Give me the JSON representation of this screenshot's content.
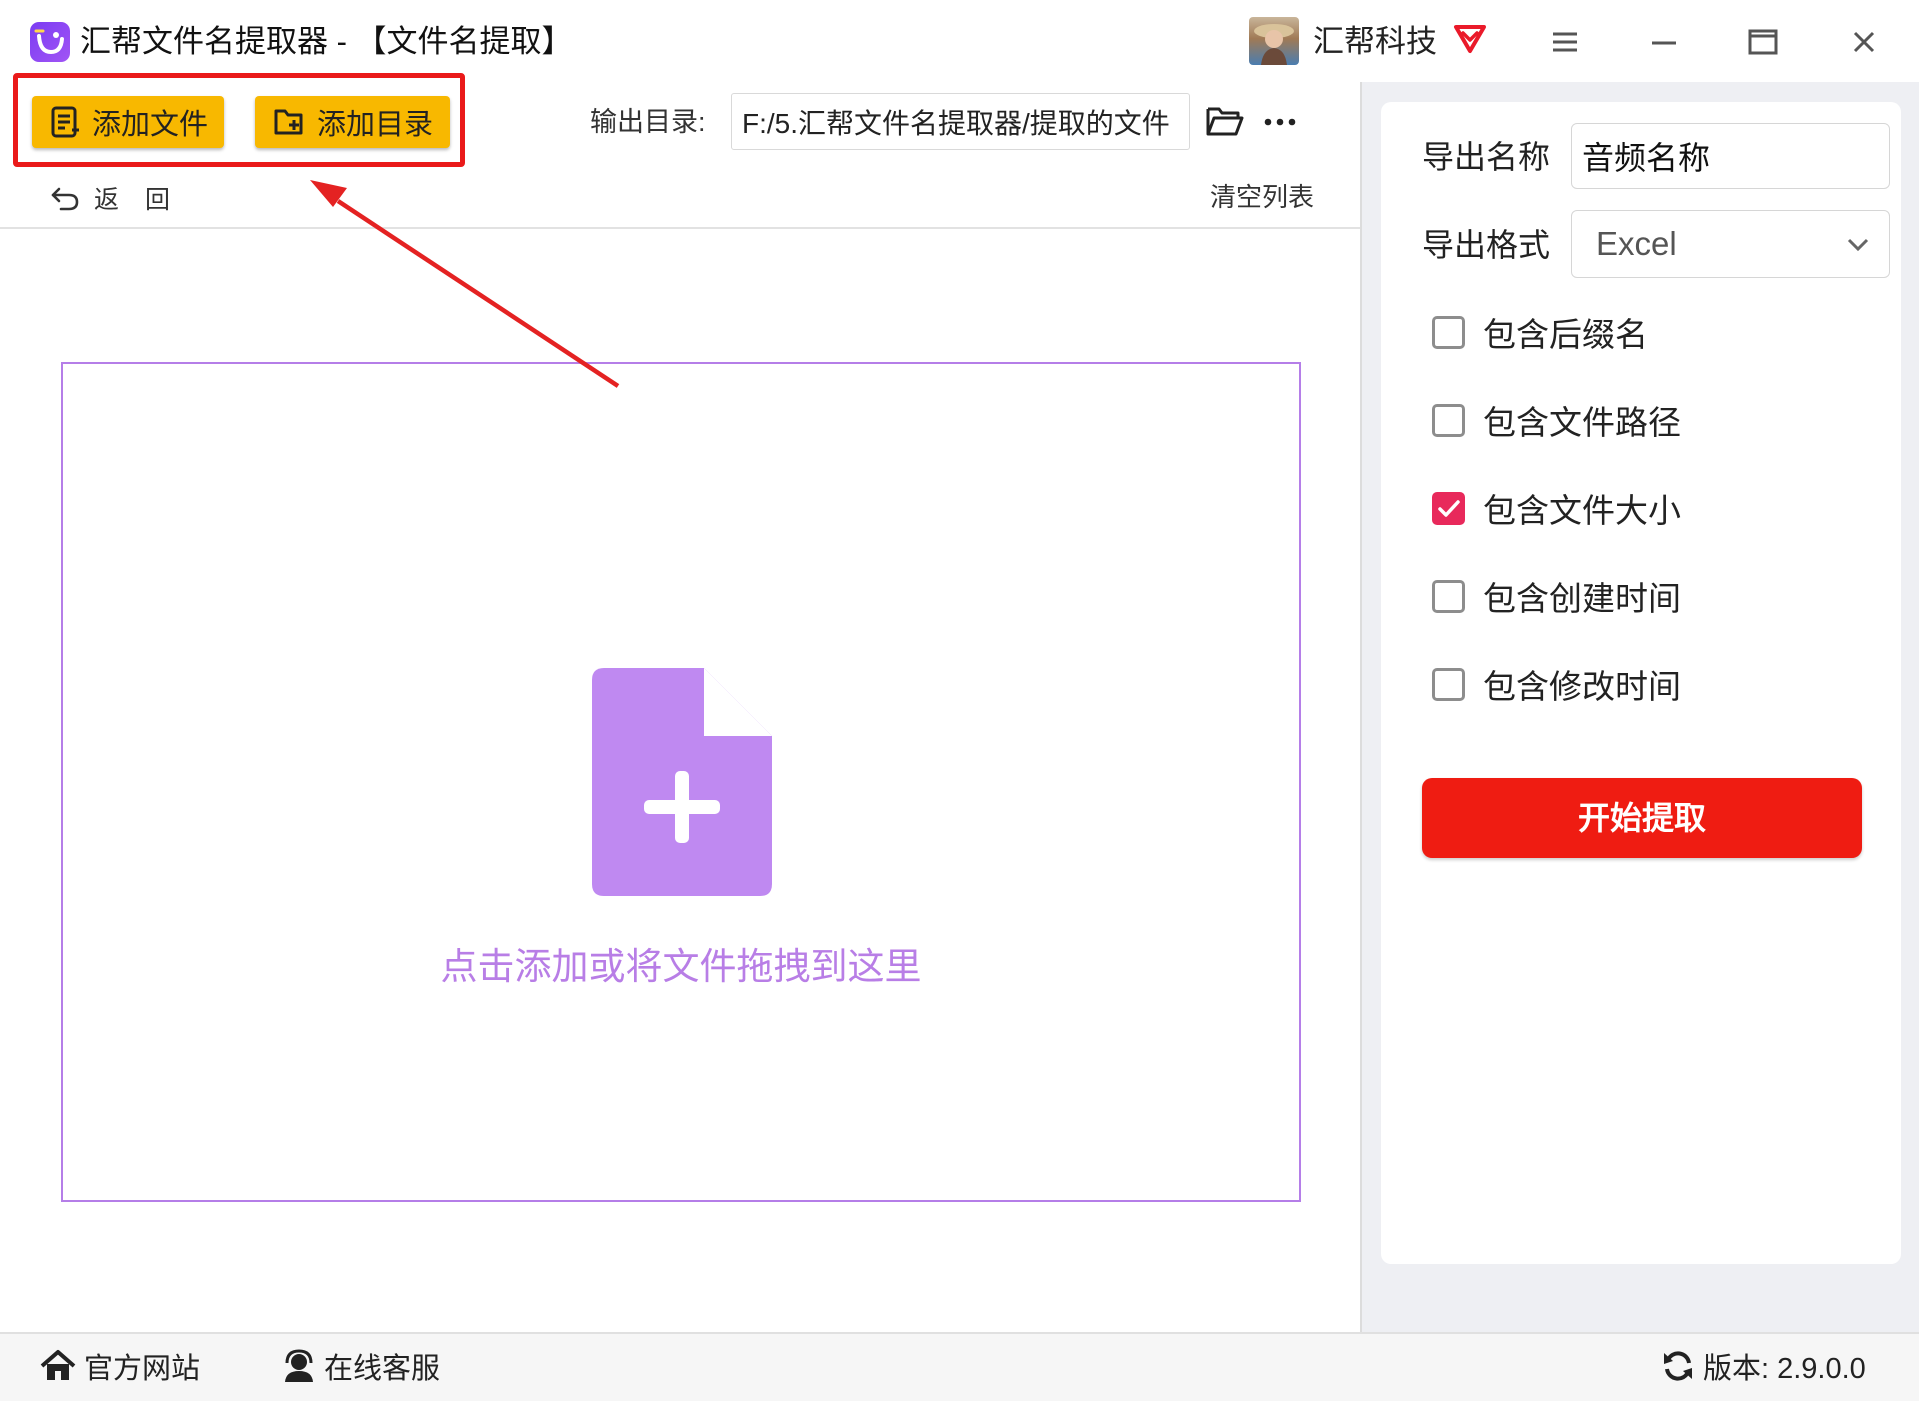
{
  "window": {
    "title": "汇帮文件名提取器 - 【文件名提取】",
    "user_name": "汇帮科技"
  },
  "toolbar": {
    "add_file_label": "添加文件",
    "add_dir_label": "添加目录",
    "output_dir_label": "输出目录:",
    "output_dir_value": "F:/5.汇帮文件名提取器/提取的文件",
    "back_label": "返回",
    "clear_list_label": "清空列表"
  },
  "drop_zone": {
    "hint_text": "点击添加或将文件拖拽到这里"
  },
  "settings": {
    "export_name_label": "导出名称",
    "export_name_value": "音频名称",
    "export_format_label": "导出格式",
    "export_format_value": "Excel",
    "options": [
      {
        "label": "包含后缀名",
        "checked": false
      },
      {
        "label": "包含文件路径",
        "checked": false
      },
      {
        "label": "包含文件大小",
        "checked": true
      },
      {
        "label": "包含创建时间",
        "checked": false
      },
      {
        "label": "包含修改时间",
        "checked": false
      }
    ],
    "start_button_label": "开始提取"
  },
  "footer": {
    "site_label": "官方网站",
    "service_label": "在线客服",
    "version_text": "版本:  2.9.0.0"
  },
  "colors": {
    "accent_yellow": "#f8b800",
    "highlight_red": "#ea1a1a",
    "start_button_red": "#ef1c12",
    "drop_purple": "#b87ee6",
    "checkbox_pink": "#e8295b"
  },
  "icons": {
    "app_logo": "app-logo-icon",
    "vip": "vip-diamond-icon",
    "menu": "hamburger-menu-icon",
    "minimize": "minimize-icon",
    "maximize": "maximize-icon",
    "close": "close-icon",
    "add_file": "file-list-icon",
    "add_dir": "folder-add-icon",
    "browse_folder": "folder-open-icon",
    "more": "more-dots-icon",
    "back": "undo-arrow-icon",
    "drop_file": "file-plus-icon",
    "home": "home-icon",
    "service": "headset-icon",
    "refresh": "refresh-icon"
  }
}
